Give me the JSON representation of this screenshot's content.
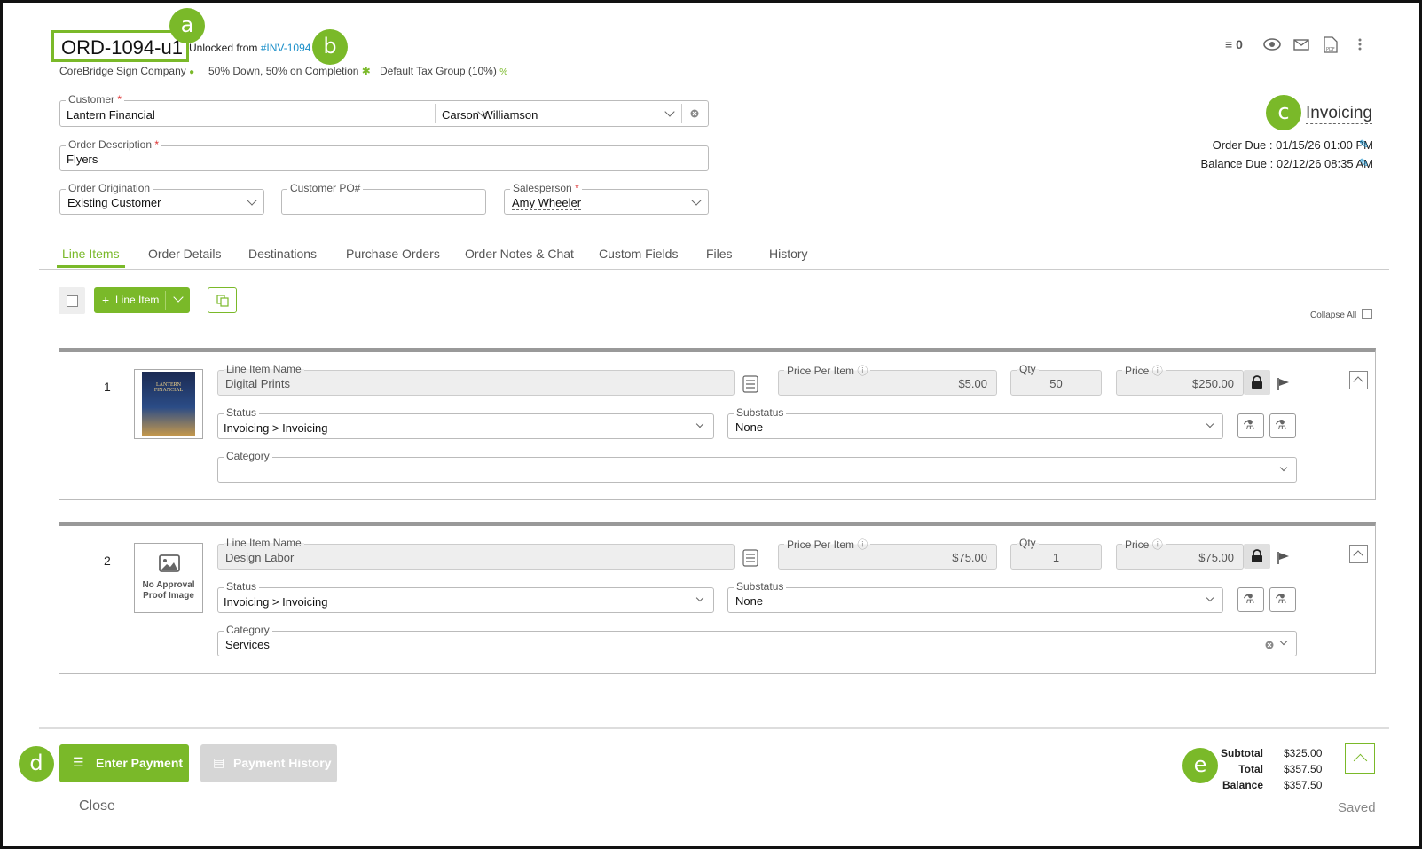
{
  "header": {
    "order_id": "ORD-1094-u1",
    "unlocked_prefix": "Unlocked from",
    "unlocked_link": "#INV-1094",
    "company": "CoreBridge Sign Company",
    "payment_terms": "50% Down, 50% on Completion",
    "tax_group": "Default Tax Group (10%)",
    "task_count": "0"
  },
  "callouts": {
    "a": "a",
    "b": "b",
    "c": "c",
    "d": "d",
    "e": "e"
  },
  "form": {
    "customer_label": "Customer",
    "customer_value": "Lantern Financial",
    "contact_value": "Carson Williamson",
    "description_label": "Order Description",
    "description_value": "Flyers",
    "origination_label": "Order Origination",
    "origination_value": "Existing Customer",
    "po_label": "Customer PO#",
    "po_value": "",
    "salesperson_label": "Salesperson",
    "salesperson_value": "Amy Wheeler",
    "required_mark": "*"
  },
  "status": {
    "label": "Invoicing",
    "order_due_label": "Order Due :",
    "order_due": "01/15/26 01:00 PM",
    "balance_due_label": "Balance Due :",
    "balance_due": "02/12/26 08:35 AM"
  },
  "tabs": [
    "Line Items",
    "Order Details",
    "Destinations",
    "Purchase Orders",
    "Order Notes & Chat",
    "Custom Fields",
    "Files",
    "History"
  ],
  "toolbar": {
    "add_line_item": "Line Item",
    "collapse_all": "Collapse All"
  },
  "line_items": [
    {
      "number": "1",
      "name_label": "Line Item Name",
      "name": "Digital Prints",
      "ppi_label": "Price Per Item",
      "ppi": "$5.00",
      "qty_label": "Qty",
      "qty": "50",
      "price_label": "Price",
      "price": "$250.00",
      "status_label": "Status",
      "status": "Invoicing > Invoicing",
      "substatus_label": "Substatus",
      "substatus": "None",
      "category_label": "Category",
      "category": "",
      "thumb_line1": "LANTERN",
      "thumb_line2": "FINANCIAL"
    },
    {
      "number": "2",
      "name_label": "Line Item Name",
      "name": "Design Labor",
      "ppi_label": "Price Per Item",
      "ppi": "$75.00",
      "qty_label": "Qty",
      "qty": "1",
      "price_label": "Price",
      "price": "$75.00",
      "status_label": "Status",
      "status": "Invoicing > Invoicing",
      "substatus_label": "Substatus",
      "substatus": "None",
      "category_label": "Category",
      "category": "Services",
      "no_image_line1": "No Approval",
      "no_image_line2": "Proof Image"
    }
  ],
  "footer": {
    "enter_payment": "Enter Payment",
    "payment_history": "Payment History",
    "close": "Close",
    "saved": "Saved",
    "subtotal_label": "Subtotal",
    "subtotal": "$325.00",
    "total_label": "Total",
    "total": "$357.50",
    "balance_label": "Balance",
    "balance": "$357.50"
  },
  "colors": {
    "accent": "#7ab929",
    "link": "#1a8fc9"
  }
}
